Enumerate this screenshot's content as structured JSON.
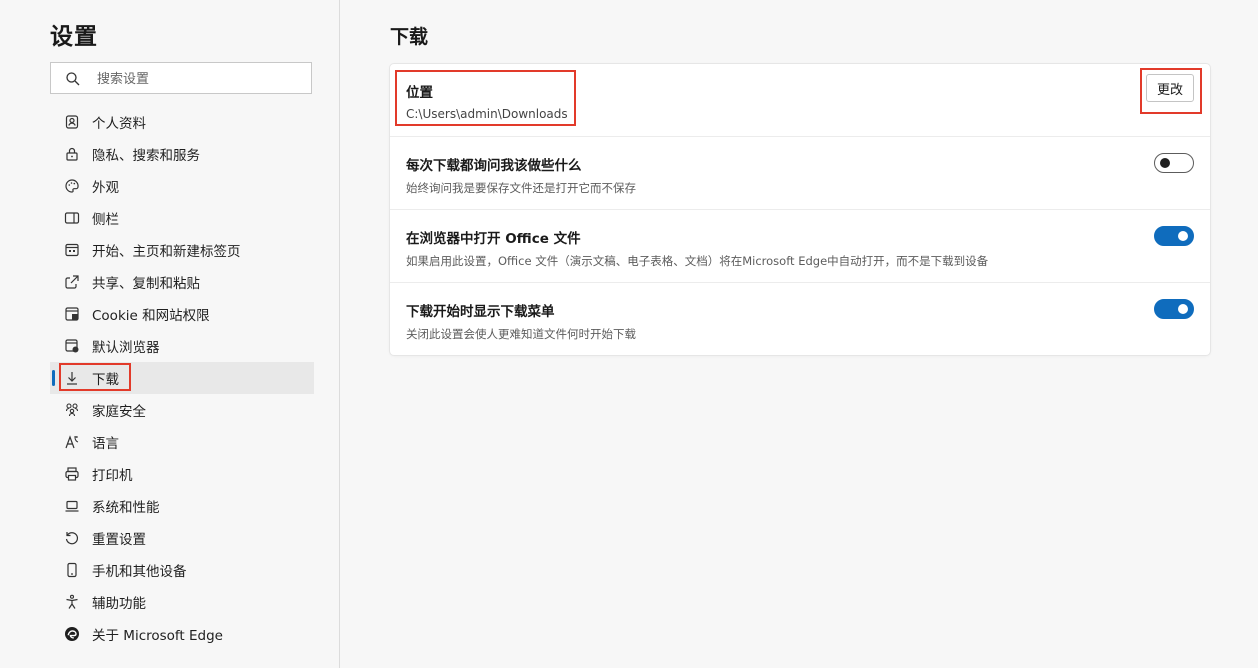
{
  "sidebar": {
    "title": "设置",
    "search_placeholder": "搜索设置",
    "items": [
      {
        "label": "个人资料",
        "icon": "profile-icon"
      },
      {
        "label": "隐私、搜索和服务",
        "icon": "lock-icon"
      },
      {
        "label": "外观",
        "icon": "palette-icon"
      },
      {
        "label": "侧栏",
        "icon": "sidebar-icon"
      },
      {
        "label": "开始、主页和新建标签页",
        "icon": "home-tab-icon"
      },
      {
        "label": "共享、复制和粘贴",
        "icon": "share-icon"
      },
      {
        "label": "Cookie 和网站权限",
        "icon": "site-permissions-icon"
      },
      {
        "label": "默认浏览器",
        "icon": "default-browser-icon"
      },
      {
        "label": "下载",
        "icon": "download-icon",
        "active": true
      },
      {
        "label": "家庭安全",
        "icon": "family-icon"
      },
      {
        "label": "语言",
        "icon": "language-icon"
      },
      {
        "label": "打印机",
        "icon": "printer-icon"
      },
      {
        "label": "系统和性能",
        "icon": "laptop-icon"
      },
      {
        "label": "重置设置",
        "icon": "reset-icon"
      },
      {
        "label": "手机和其他设备",
        "icon": "phone-icon"
      },
      {
        "label": "辅助功能",
        "icon": "accessibility-icon"
      },
      {
        "label": "关于 Microsoft Edge",
        "icon": "edge-logo-icon"
      }
    ]
  },
  "main": {
    "title": "下载",
    "location": {
      "title": "位置",
      "path": "C:\\Users\\admin\\Downloads",
      "button_label": "更改"
    },
    "settings": [
      {
        "title": "每次下载都询问我该做些什么",
        "desc": "始终询问我是要保存文件还是打开它而不保存",
        "enabled": false
      },
      {
        "title": "在浏览器中打开 Office 文件",
        "desc": "如果启用此设置，Office 文件（演示文稿、电子表格、文档）将在Microsoft Edge中自动打开，而不是下载到设备",
        "enabled": true
      },
      {
        "title": "下载开始时显示下载菜单",
        "desc": "关闭此设置会使人更难知道文件何时开始下载",
        "enabled": true
      }
    ]
  },
  "colors": {
    "accent": "#0f6cbd",
    "highlight": "#e23a2a"
  }
}
